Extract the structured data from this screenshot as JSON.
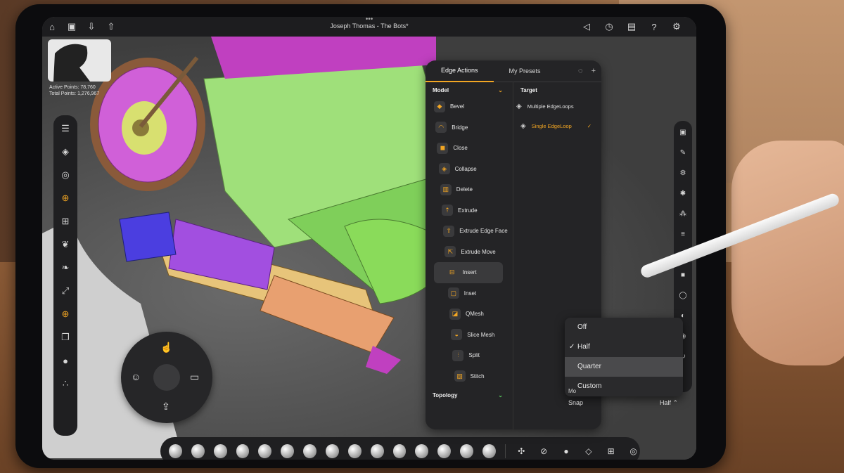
{
  "window": {
    "title": "Joseph Thomas - The Bots*",
    "dots": "•••"
  },
  "stats": {
    "active": "Active Points: 78,760",
    "total": "Total Points: 1,276,967"
  },
  "panel": {
    "tabs": [
      {
        "label": "Edge Actions"
      },
      {
        "label": "My Presets"
      }
    ],
    "model_header": "Model",
    "target_header": "Target",
    "topology_header": "Topology",
    "model_items": [
      {
        "label": "Bevel"
      },
      {
        "label": "Bridge"
      },
      {
        "label": "Close"
      },
      {
        "label": "Collapse"
      },
      {
        "label": "Delete"
      },
      {
        "label": "Extrude"
      },
      {
        "label": "Extrude Edge Face"
      },
      {
        "label": "Extrude Move"
      },
      {
        "label": "Insert"
      },
      {
        "label": "Inset"
      },
      {
        "label": "QMesh"
      },
      {
        "label": "Slice Mesh"
      },
      {
        "label": "Split"
      },
      {
        "label": "Stitch"
      }
    ],
    "selected_item": "Insert",
    "targets": [
      {
        "label": "Multiple EdgeLoops"
      },
      {
        "label": "Single EdgeLoop"
      }
    ],
    "selected_target": "Single EdgeLoop"
  },
  "dropdown": {
    "options": [
      {
        "label": "Off"
      },
      {
        "label": "Half"
      },
      {
        "label": "Quarter"
      },
      {
        "label": "Custom"
      }
    ],
    "checked": "Half",
    "highlighted": "Quarter"
  },
  "snap": {
    "label": "Snap",
    "value": "Half",
    "m_label": "Mo"
  },
  "colors": {
    "accent": "#f2a623",
    "panel": "#242426"
  }
}
